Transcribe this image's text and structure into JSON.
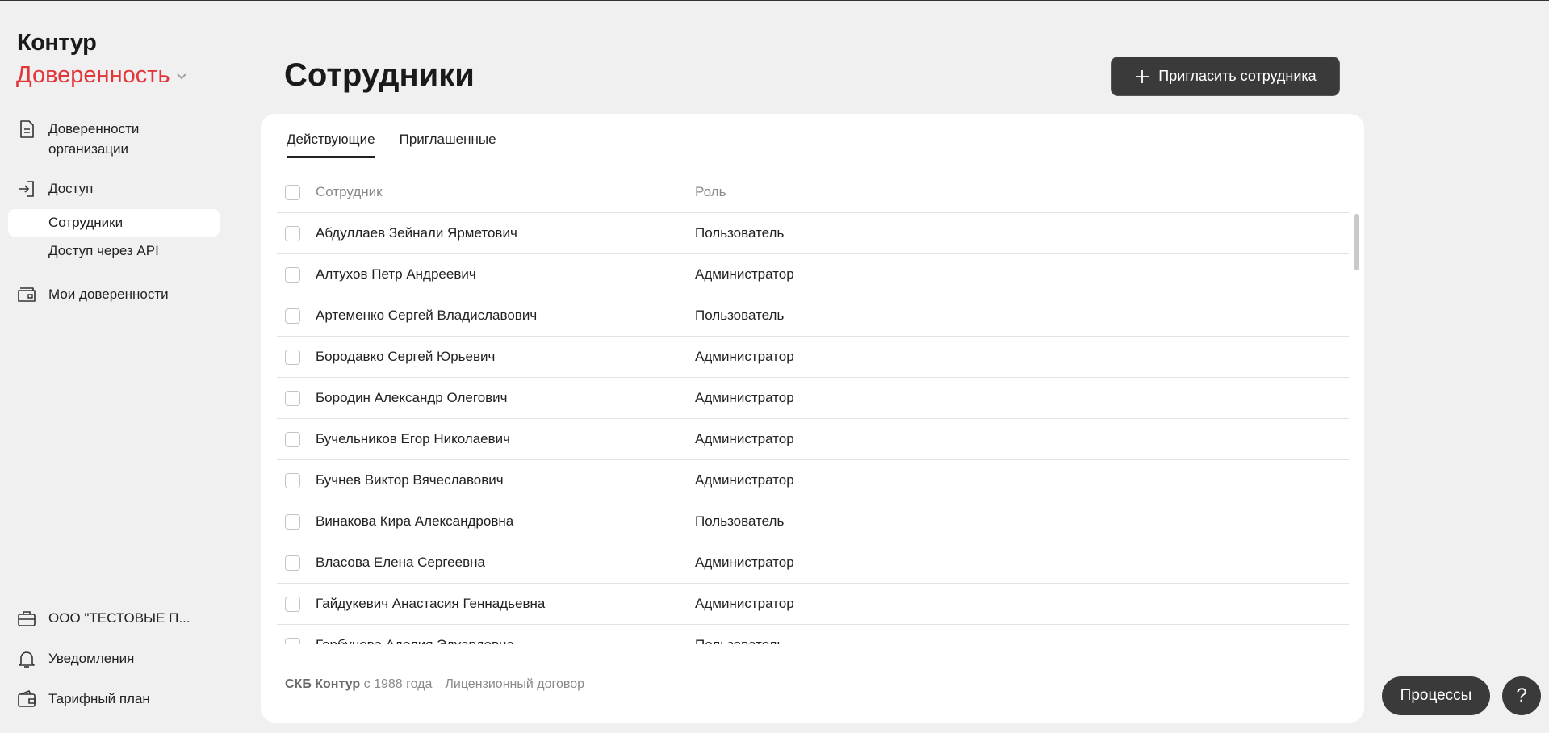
{
  "sidebar": {
    "logo": "Контур",
    "product": "Доверенность",
    "nav": {
      "org_powers": "Доверенности организации",
      "access": "Доступ",
      "employees": "Сотрудники",
      "api_access": "Доступ через API",
      "my_powers": "Мои доверенности"
    },
    "bottom": {
      "organization": "ООО \"ТЕСТОВЫЕ П...",
      "notifications": "Уведомления",
      "tariff": "Тарифный план"
    }
  },
  "header": {
    "title": "Сотрудники",
    "invite_label": "Пригласить сотрудника"
  },
  "tabs": {
    "active": "Действующие",
    "invited": "Приглашенные"
  },
  "table": {
    "headers": {
      "employee": "Сотрудник",
      "role": "Роль"
    },
    "rows": [
      {
        "name": "Абдуллаев Зейнали Ярметович",
        "role": "Пользователь"
      },
      {
        "name": "Алтухов Петр Андреевич",
        "role": "Администратор"
      },
      {
        "name": "Артеменко Сергей Владиславович",
        "role": "Пользователь"
      },
      {
        "name": "Бородавко Сергей Юрьевич",
        "role": "Администратор"
      },
      {
        "name": "Бородин Александр Олегович",
        "role": "Администратор"
      },
      {
        "name": "Бучельников Егор Николаевич",
        "role": "Администратор"
      },
      {
        "name": "Бучнев Виктор Вячеславович",
        "role": "Администратор"
      },
      {
        "name": "Винакова Кира Александровна",
        "role": "Пользователь"
      },
      {
        "name": "Власова Елена Сергеевна",
        "role": "Администратор"
      },
      {
        "name": "Гайдукевич Анастасия Геннадьевна",
        "role": "Администратор"
      },
      {
        "name": "Горбунова Аделия Эдуардовна",
        "role": "Пользователь"
      }
    ]
  },
  "footer": {
    "brand": "СКБ Контур",
    "since": "с 1988 года",
    "license": "Лицензионный договор"
  },
  "floating": {
    "processes": "Процессы",
    "help": "?"
  },
  "colors": {
    "accent_red": "#e2353a",
    "dark_button": "#3a3a3a",
    "background": "#f0f0f0"
  },
  "icons": {
    "org_powers": "document-icon",
    "access": "login-icon",
    "my_powers": "folder-icon",
    "organization": "briefcase-icon",
    "notifications": "bell-icon",
    "tariff": "wallet-icon",
    "invite": "plus-icon"
  }
}
